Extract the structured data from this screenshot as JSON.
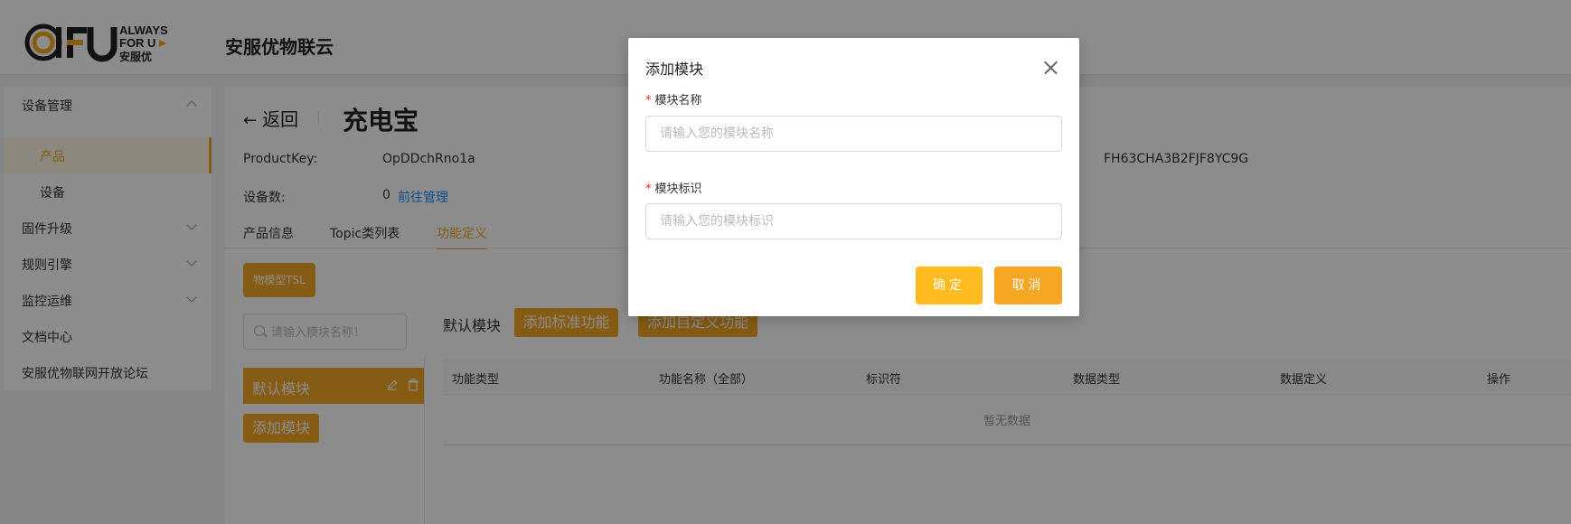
{
  "header": {
    "logo_text": "AFU ALWAYS FOR U 安服优",
    "brand_title": "安服优物联云"
  },
  "sidebar": {
    "groups": [
      {
        "label": "设备管理",
        "expanded": true
      },
      {
        "label": "产品",
        "active": true
      },
      {
        "label": "设备"
      },
      {
        "label": "固件升级",
        "expanded": false
      },
      {
        "label": "规则引擎",
        "expanded": false
      },
      {
        "label": "监控运维",
        "expanded": false
      },
      {
        "label": "文档中心"
      },
      {
        "label": "安服优物联网开放论坛"
      }
    ]
  },
  "content": {
    "back_label": "返回",
    "page_title": "充电宝",
    "product_key_label": "ProductKey:",
    "product_key_value": "OpDDchRno1a",
    "product_secret_value": "FH63CHA3B2FJF8YC9G",
    "device_count_label": "设备数:",
    "device_count_value": "0",
    "manage_link": "前往管理",
    "tabs": [
      {
        "label": "产品信息"
      },
      {
        "label": "Topic类列表"
      },
      {
        "label": "功能定义",
        "active": true
      }
    ],
    "tsl_button": "物模型TSL",
    "module_search_placeholder": "请输入模块名称！",
    "module_item_label": "默认模块",
    "add_module_button": "添加模块",
    "default_module_label": "默认模块",
    "add_standard_button": "添加标准功能",
    "add_custom_button": "添加自定义功能",
    "table": {
      "columns": [
        "功能类型",
        "功能名称（全部）",
        "标识符",
        "数据类型",
        "数据定义",
        "操作"
      ],
      "empty_text": "暂无数据"
    }
  },
  "modal": {
    "title": "添加模块",
    "fields": [
      {
        "label": "模块名称",
        "placeholder": "请输入您的模块名称",
        "value": ""
      },
      {
        "label": "模块标识",
        "placeholder": "请输入您的模块标识",
        "value": ""
      }
    ],
    "ok_button": "确定",
    "cancel_button": "取消"
  },
  "colors": {
    "accent": "#f5a623",
    "ok_button": "#ffbb1f",
    "link": "#1890ff",
    "required": "#f5222d"
  }
}
